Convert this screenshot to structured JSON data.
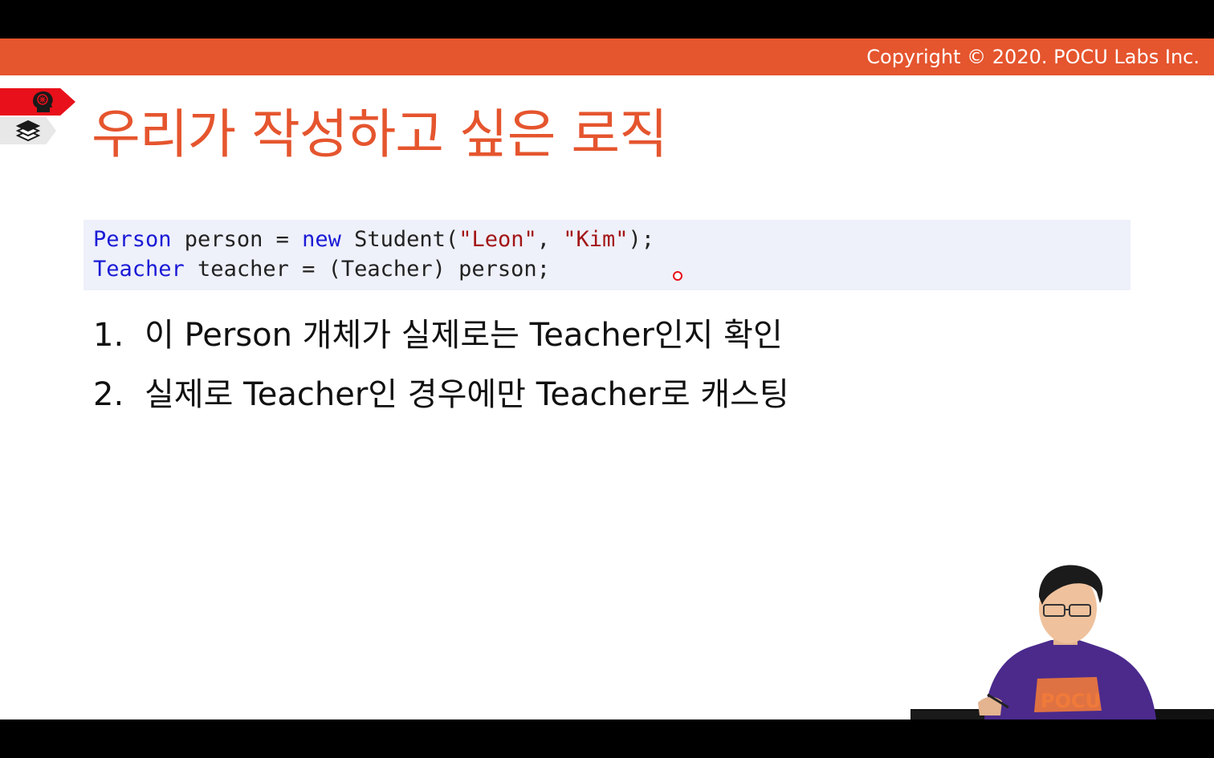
{
  "header": {
    "copyright": "Copyright © 2020. POCU Labs Inc."
  },
  "sidebar_tabs": [
    {
      "icon": "brain-head-icon",
      "color": "#e8101a"
    },
    {
      "icon": "books-stack-icon",
      "color": "#e8e8e8"
    }
  ],
  "title": "우리가 작성하고 싶은 로직",
  "code": {
    "line1": {
      "type": "Person",
      "decl": " person = ",
      "kw_new": "new",
      "ctor": " Student(",
      "arg1": "\"Leon\"",
      "sep": ", ",
      "arg2": "\"Kim\"",
      "end": ");"
    },
    "line2": {
      "type": "Teacher",
      "rest": " teacher = (Teacher) person;"
    }
  },
  "list": [
    {
      "num": "1.",
      "text": "이 Person 개체가 실제로는 Teacher인지 확인"
    },
    {
      "num": "2.",
      "text": "실제로 Teacher인 경우에만 Teacher로 캐스팅"
    }
  ],
  "presenter": {
    "shirt_logo": "POCU"
  },
  "colors": {
    "accent": "#e5552e",
    "keyword": "#1a1ad6",
    "string": "#a31515",
    "code_bg": "#eef0fa"
  }
}
